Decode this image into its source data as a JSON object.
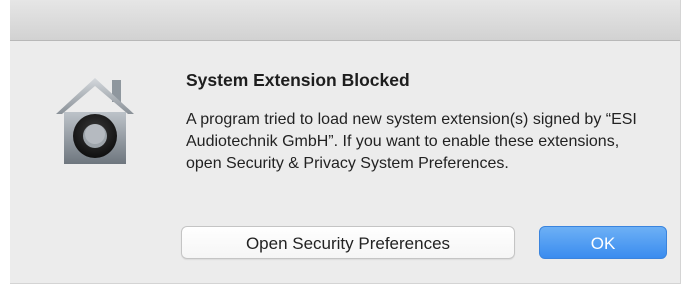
{
  "dialog": {
    "title": "System Extension Blocked",
    "message": "A program tried to load new system extension(s) signed by “ESI Audiotechnik GmbH”.  If you want to enable these extensions, open Security & Privacy System Preferences.",
    "icon": "security-lock-house-icon",
    "secondary_button_label": "Open Security Preferences",
    "primary_button_label": "OK"
  },
  "colors": {
    "primary_button": "#3a8cef",
    "dialog_background": "#ececec"
  }
}
